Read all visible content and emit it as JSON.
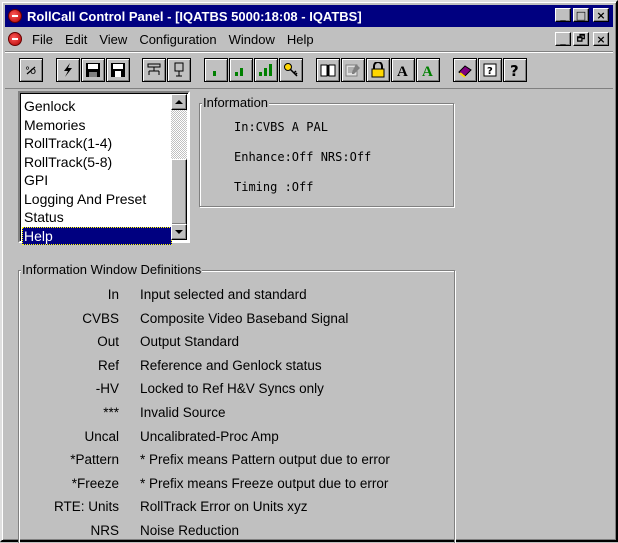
{
  "window": {
    "title": "RollCall Control Panel - [IQATBS 5000:18:08 - IQATBS]",
    "controls": {
      "minimize": "_",
      "maximize": "□",
      "close": "×",
      "restore": "🗗"
    }
  },
  "menubar": {
    "items": [
      {
        "label": "File"
      },
      {
        "label": "Edit"
      },
      {
        "label": "View"
      },
      {
        "label": "Configuration"
      },
      {
        "label": "Window"
      },
      {
        "label": "Help"
      }
    ]
  },
  "toolbar": {
    "buttons": [
      {
        "icon": "route-icon"
      },
      {
        "icon": "lightning-icon"
      },
      {
        "icon": "save-icon"
      },
      {
        "icon": "save-all-icon"
      },
      {
        "icon": "network-icon"
      },
      {
        "icon": "device-icon"
      },
      {
        "icon": "signal-low-icon"
      },
      {
        "icon": "signal-medium-icon"
      },
      {
        "icon": "signal-high-icon"
      },
      {
        "icon": "key-icon"
      },
      {
        "icon": "book-icon"
      },
      {
        "icon": "edit-doc-icon"
      },
      {
        "icon": "lock-icon"
      },
      {
        "icon": "font-a-icon"
      },
      {
        "icon": "font-a-green-icon"
      },
      {
        "icon": "help-book-icon"
      },
      {
        "icon": "context-help-icon"
      },
      {
        "icon": "question-icon"
      }
    ]
  },
  "nav_list": {
    "items": [
      "Genlock",
      "Memories",
      "RollTrack(1-4)",
      "RollTrack(5-8)",
      "GPI",
      "Logging And Preset",
      "Status",
      "Help"
    ],
    "selected": "Help"
  },
  "info_panel": {
    "title": "Information",
    "lines": [
      "In:CVBS A PAL",
      "Enhance:Off NRS:Off",
      "Timing :Off"
    ]
  },
  "definitions": {
    "title": "Information Window Definitions",
    "rows": [
      {
        "key": "In",
        "value": "Input selected and standard"
      },
      {
        "key": "CVBS",
        "value": "Composite Video Baseband Signal"
      },
      {
        "key": "Out",
        "value": "Output Standard"
      },
      {
        "key": "Ref",
        "value": "Reference and Genlock status"
      },
      {
        "key": "-HV",
        "value": "Locked to Ref H&V Syncs only"
      },
      {
        "key": "***",
        "value": "Invalid Source"
      },
      {
        "key": "Uncal",
        "value": "Uncalibrated-Proc Amp"
      },
      {
        "key": "*Pattern",
        "value": "* Prefix means Pattern output due to error"
      },
      {
        "key": "*Freeze",
        "value": "* Prefix means Freeze output due to error"
      },
      {
        "key": "RTE: Units",
        "value": "RollTrack Error on Units xyz"
      },
      {
        "key": "NRS",
        "value": "Noise Reduction"
      }
    ]
  },
  "colors": {
    "titlebar": "#000080",
    "selection": "#000080",
    "face": "#c0c0c0"
  }
}
